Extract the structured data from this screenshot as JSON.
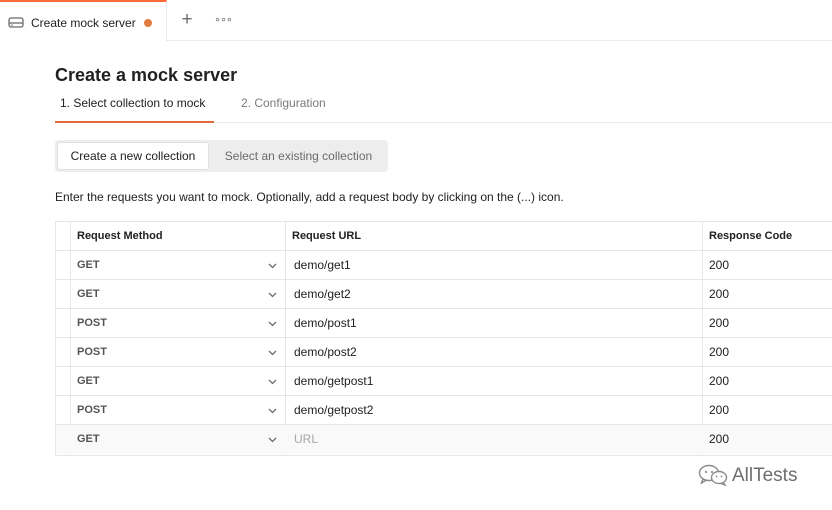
{
  "tab": {
    "icon": "mock-server-icon",
    "label": "Create mock server",
    "unsaved_color": "#e27d3f"
  },
  "tabbar": {
    "add_icon": "plus-icon",
    "more_icon": "ellipsis-icon"
  },
  "page": {
    "title": "Create a mock server",
    "steps": [
      {
        "label": "1.  Select collection to mock",
        "active": true
      },
      {
        "label": "2.  Configuration",
        "active": false
      }
    ],
    "collection_options": [
      {
        "label": "Create a new collection",
        "selected": true
      },
      {
        "label": "Select an existing collection",
        "selected": false
      }
    ],
    "helper_text": "Enter the requests you want to mock. Optionally, add a request body by clicking on the (...) icon."
  },
  "table": {
    "headers": [
      "Request Method",
      "Request URL",
      "Response Code"
    ],
    "rows": [
      {
        "method": "GET",
        "url": "demo/get1",
        "code": "200"
      },
      {
        "method": "GET",
        "url": "demo/get2",
        "code": "200"
      },
      {
        "method": "POST",
        "url": "demo/post1",
        "code": "200"
      },
      {
        "method": "POST",
        "url": "demo/post2",
        "code": "200"
      },
      {
        "method": "GET",
        "url": "demo/getpost1",
        "code": "200"
      },
      {
        "method": "POST",
        "url": "demo/getpost2",
        "code": "200"
      }
    ],
    "new_row": {
      "method": "GET",
      "url_placeholder": "URL",
      "code": "200"
    }
  },
  "watermark": {
    "icon": "wechat-icon",
    "text": "AllTests"
  },
  "colors": {
    "accent": "#ff6c37",
    "active_underline": "#e06c3c"
  }
}
